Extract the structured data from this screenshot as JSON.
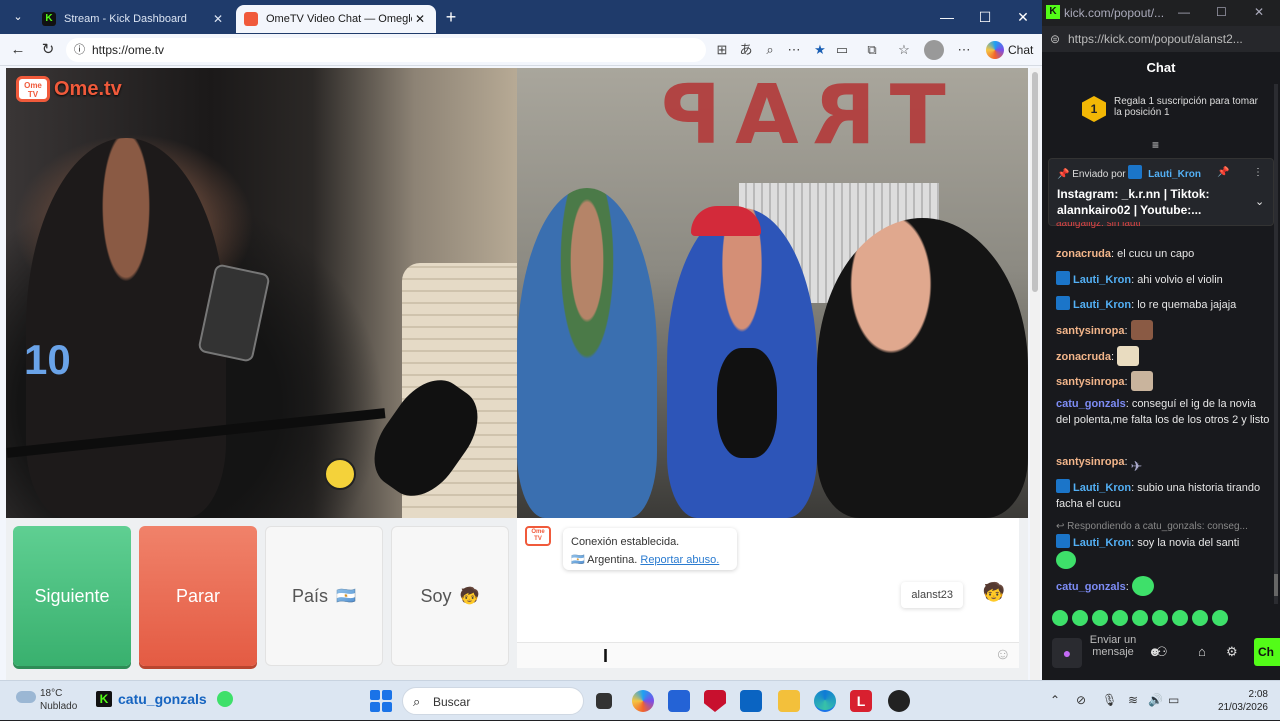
{
  "browser": {
    "tabs": [
      {
        "title": "Stream - Kick Dashboard",
        "icon": "kick-icon",
        "active": false
      },
      {
        "title": "OmeTV Video Chat — Omegle",
        "icon": "ometv-icon",
        "active": true
      }
    ],
    "url": "https://ome.tv",
    "chat_label": "Chat"
  },
  "page": {
    "logo_text": "Ome.tv",
    "logo_badge": "Ome TV",
    "wall_text": "TRAP",
    "buttons": {
      "next": "Siguiente",
      "stop": "Parar",
      "country": "País",
      "gender": "Soy"
    },
    "system_message": {
      "line1": "Conexión establecida.",
      "country": "Argentina.",
      "report": "Reportar abuso."
    },
    "user_tag": "alanst23",
    "colors": {
      "accent": "#f05a3b",
      "next": "#39b06e",
      "stop": "#e45b43"
    }
  },
  "popout": {
    "url": "https://kick.com/popout/alanst2...",
    "window_title": "kick.com/popout/...",
    "chat_title": "Chat",
    "gift": {
      "rank": "1",
      "text": "Regala 1 suscripción para tomar la posición 1"
    },
    "pinned": {
      "prefix": "Enviado por",
      "user": "Lauti_Kron",
      "body": "Instagram: _k.r.nn | Tiktok: alannkairo02 | Youtube:..."
    },
    "messages": [
      {
        "user": "zonacruda",
        "color": "#f2b58a",
        "text": "el cucu un capo",
        "badge": false
      },
      {
        "user": "Lauti_Kron",
        "color": "#53b0f5",
        "text": "ahi volvio el violin",
        "badge": true
      },
      {
        "user": "Lauti_Kron",
        "color": "#53b0f5",
        "text": "lo re quemaba jajaja",
        "badge": true
      },
      {
        "user": "santysinropa",
        "color": "#f2b58a",
        "text": "",
        "badge": false
      },
      {
        "user": "zonacruda",
        "color": "#f2b58a",
        "text": "",
        "badge": false
      },
      {
        "user": "santysinropa",
        "color": "#f2b58a",
        "text": "",
        "badge": false
      },
      {
        "user": "catu_gonzals",
        "color": "#7d8cf5",
        "text": "conseguí el ig de la novia del polenta,me falta los de los otros 2 y listo",
        "badge": false
      },
      {
        "user": "santysinropa",
        "color": "#f2b58a",
        "text": "",
        "badge": false
      },
      {
        "user": "Lauti_Kron",
        "color": "#53b0f5",
        "text": "subio una historia tirando facha el cucu",
        "badge": true
      },
      {
        "user": "Lauti_Kron",
        "color": "#53b0f5",
        "text": "soy la novia del santi",
        "badge": true
      },
      {
        "user": "catu_gonzals",
        "color": "#7d8cf5",
        "text": "",
        "badge": false
      }
    ],
    "partial_top": "aaulgaligz: sin lauti",
    "reply_hint": "Respondiendo a catu_gonzals: conseg...",
    "send_placeholder": "Enviar un mensaje",
    "send_button": "Ch"
  },
  "taskbar": {
    "weather_temp": "18°C",
    "weather_desc": "Nublado",
    "kick_user": "catu_gonzals",
    "search": "Buscar",
    "time": "2:08",
    "date": "21/03/2026"
  }
}
